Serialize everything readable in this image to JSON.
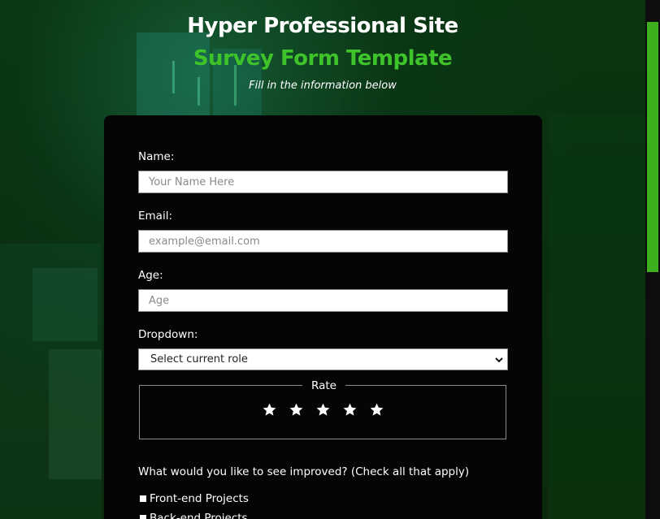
{
  "header": {
    "site_title": "Hyper Professional Site",
    "form_title": "Survey Form Template",
    "tagline": "Fill in the information below"
  },
  "form": {
    "name": {
      "label": "Name:",
      "placeholder": "Your Name Here",
      "value": ""
    },
    "email": {
      "label": "Email:",
      "placeholder": "example@email.com",
      "value": ""
    },
    "age": {
      "label": "Age:",
      "placeholder": "Age",
      "value": ""
    },
    "dropdown": {
      "label": "Dropdown:",
      "selected": "Select current role"
    },
    "rate": {
      "legend": "Rate",
      "star_count": 5,
      "star_icon": "star-icon"
    },
    "improve": {
      "question": "What would you like to see improved? (Check all that apply)",
      "options": [
        "Front-end Projects",
        "Back-end Projects"
      ]
    }
  },
  "colors": {
    "accent": "#3ec42a",
    "card": "#050505",
    "scrollbar_thumb": "#3db020"
  }
}
